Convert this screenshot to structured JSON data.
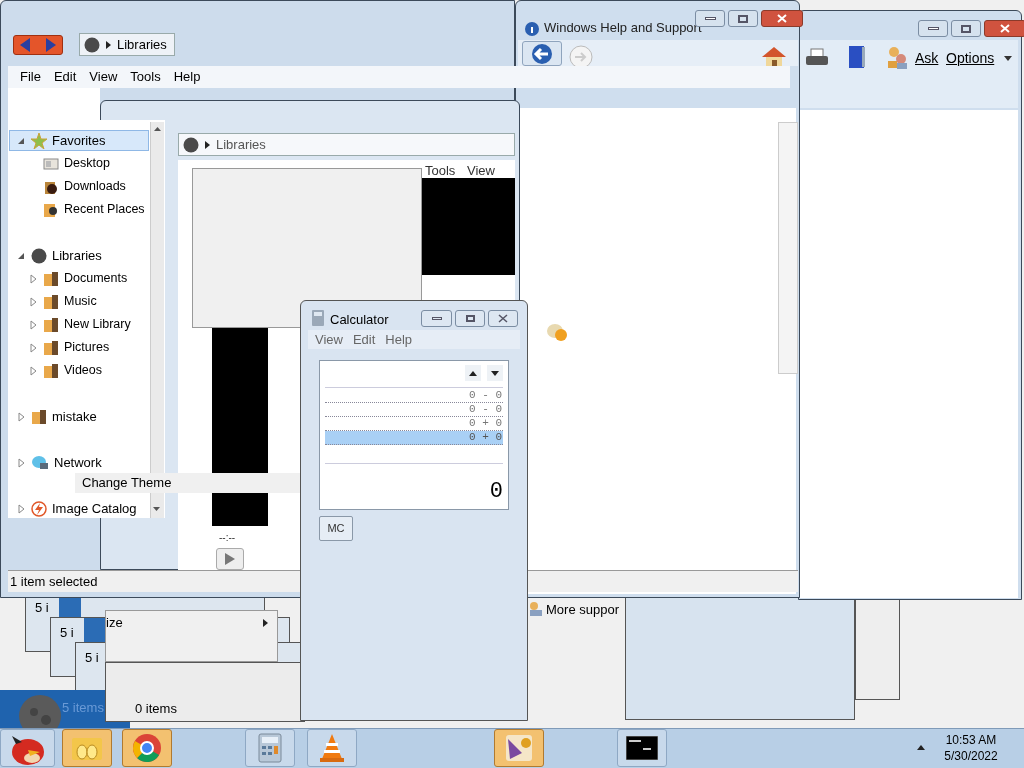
{
  "explorer": {
    "breadcrumb": "Libraries",
    "menu": [
      "File",
      "Edit",
      "View",
      "Tools",
      "Help"
    ],
    "tree": [
      {
        "label": "Favorites",
        "kind": "favorites",
        "expanded": true,
        "selected": true,
        "children": [
          {
            "label": "Desktop",
            "kind": "desktop"
          },
          {
            "label": "Downloads",
            "kind": "downloads"
          },
          {
            "label": "Recent Places",
            "kind": "recent"
          }
        ]
      },
      {
        "label": "Libraries",
        "kind": "libraries",
        "expanded": true,
        "selected": false,
        "children": [
          {
            "label": "Documents",
            "kind": "folder",
            "expanded": false
          },
          {
            "label": "Music",
            "kind": "folder",
            "expanded": false
          },
          {
            "label": "New Library",
            "kind": "folder",
            "expanded": false
          },
          {
            "label": "Pictures",
            "kind": "folder",
            "expanded": false
          },
          {
            "label": "Videos",
            "kind": "folder",
            "expanded": false
          }
        ]
      },
      {
        "label": "mistake",
        "kind": "folder",
        "expanded": false,
        "selected": false
      },
      {
        "label": "Network",
        "kind": "network",
        "expanded": false,
        "selected": false
      },
      {
        "label": "Image Catalog",
        "kind": "catalog",
        "expanded": false,
        "selected": false
      }
    ],
    "status": "1 item selected"
  },
  "inner_explorer": {
    "breadcrumb": "Libraries",
    "player_menu": [
      "Tools",
      "View"
    ],
    "time": "--:--"
  },
  "theme_menu": {
    "label": "Change Theme"
  },
  "help_window": {
    "title": "Windows Help and Support",
    "toolbar": [
      "Ask",
      "Options"
    ],
    "link": "More suppor"
  },
  "stacked_windows": [
    {
      "status": "5 i"
    },
    {
      "status": "5 i"
    },
    {
      "status": "5 i"
    }
  ],
  "back_status": "5 items",
  "items_window": {
    "status": "0 items"
  },
  "context_menu": {
    "label": "ize"
  },
  "calculator": {
    "title": "Calculator",
    "menu": [
      "View",
      "Edit",
      "Help"
    ],
    "history": [
      {
        "expr": "0 - 0",
        "selected": false
      },
      {
        "expr": "0 - 0",
        "selected": false
      },
      {
        "expr": "0 + 0",
        "selected": false
      },
      {
        "expr": "0 + 0",
        "selected": true
      }
    ],
    "display": "0",
    "memory_button": "MC"
  },
  "taskbar": {
    "items": [
      {
        "kind": "bird",
        "highlighted": false
      },
      {
        "kind": "folder",
        "highlighted": true
      },
      {
        "kind": "browser",
        "highlighted": true
      },
      {
        "kind": "calculator",
        "highlighted": false
      },
      {
        "kind": "cone",
        "highlighted": false
      },
      {
        "kind": "app",
        "highlighted": true
      },
      {
        "kind": "console",
        "highlighted": false
      }
    ],
    "time": "10:53 AM",
    "date": "5/30/2022"
  }
}
